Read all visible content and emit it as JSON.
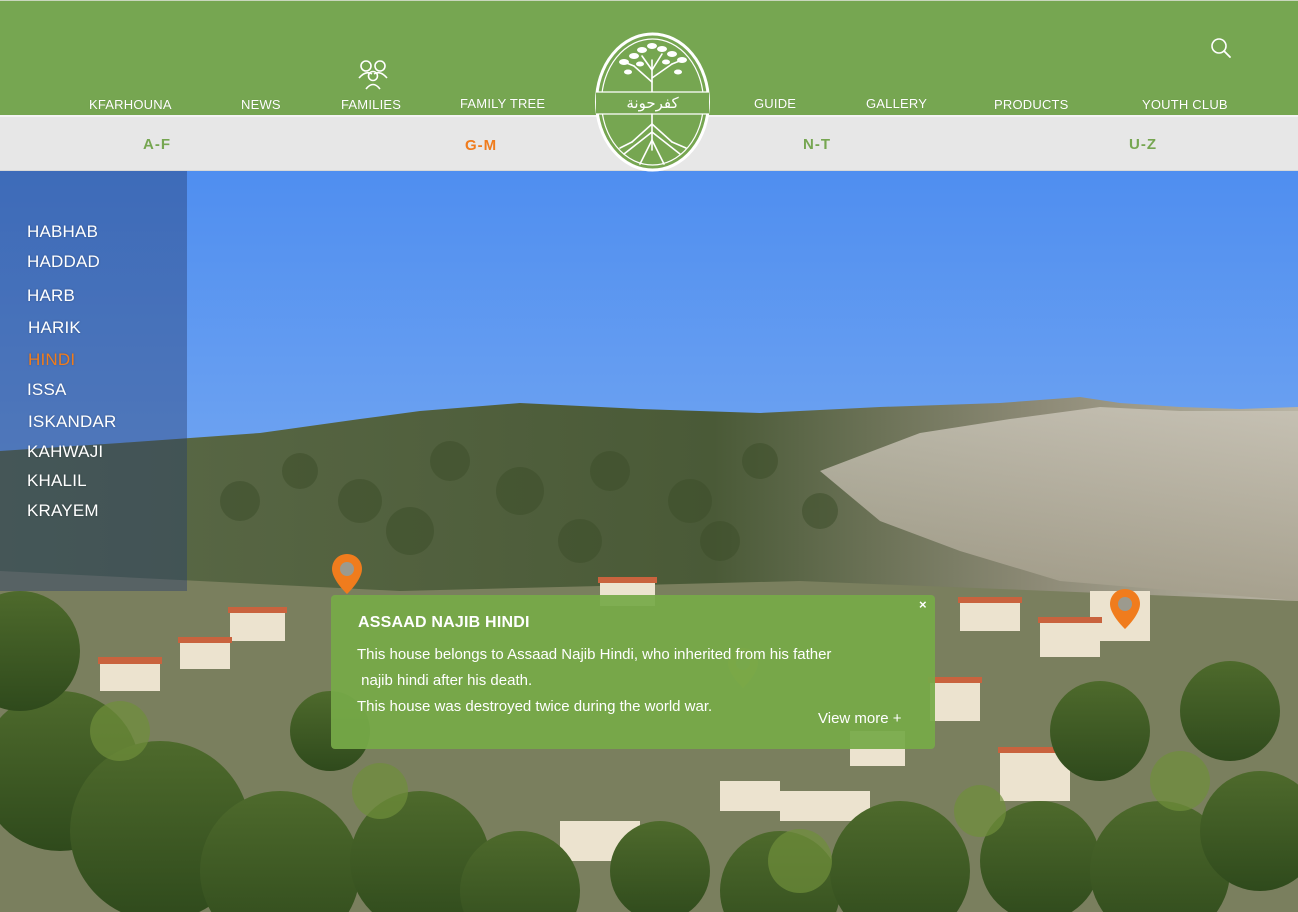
{
  "nav": {
    "items": [
      {
        "label": "KFARHOUNA"
      },
      {
        "label": "NEWS"
      },
      {
        "label": "FAMILIES"
      },
      {
        "label": "FAMILY TREE"
      },
      {
        "label": "GUIDE"
      },
      {
        "label": "GALLERY"
      },
      {
        "label": "PRODUCTS"
      },
      {
        "label": "YOUTH CLUB"
      }
    ],
    "search_icon": "search-icon",
    "families_icon": "family-icon"
  },
  "logo": {
    "text": "كفرحونة",
    "icon": "tree-roots-logo"
  },
  "letter_tabs": [
    {
      "label": "A-F",
      "active": false
    },
    {
      "label": "G-M",
      "active": true
    },
    {
      "label": "N-T",
      "active": false
    },
    {
      "label": "U-Z",
      "active": false
    }
  ],
  "families": [
    {
      "label": "HABHAB"
    },
    {
      "label": "HADDAD"
    },
    {
      "label": "HARB"
    },
    {
      "label": "HARIK"
    },
    {
      "label": "HINDI",
      "active": true
    },
    {
      "label": "ISSA"
    },
    {
      "label": "ISKANDAR"
    },
    {
      "label": "KAHWAJI"
    },
    {
      "label": "KHALIL"
    },
    {
      "label": "KRAYEM"
    }
  ],
  "popup": {
    "title": "ASSAAD NAJIB HINDI",
    "line1": "This house belongs to Assaad Najib Hindi, who inherited from his father",
    "line2": " najib hindi after his death.",
    "line3": "This house was destroyed twice during the world war.",
    "more": "View more +",
    "close": "×"
  },
  "colors": {
    "brand_green": "#76a651",
    "accent_orange": "#f07c1d",
    "letter_band": "#e7e7e7"
  }
}
